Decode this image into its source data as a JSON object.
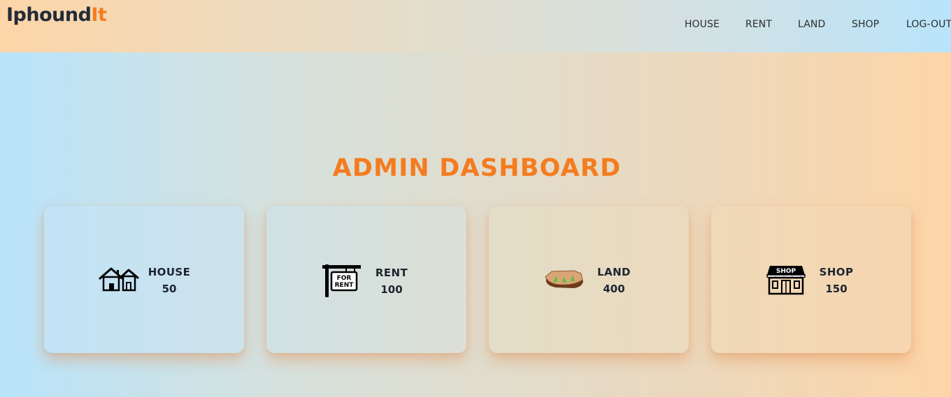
{
  "brand": {
    "name_main": "Iphound",
    "name_accent": "It"
  },
  "nav": {
    "items": [
      {
        "label": "HOUSE"
      },
      {
        "label": "RENT"
      },
      {
        "label": "LAND"
      },
      {
        "label": "SHOP"
      },
      {
        "label": "LOG-OUT"
      }
    ]
  },
  "page": {
    "title": "ADMIN DASHBOARD"
  },
  "cards": [
    {
      "label": "HOUSE",
      "count": "50",
      "icon": "houses-icon"
    },
    {
      "label": "RENT",
      "count": "100",
      "icon": "for-rent-sign-icon",
      "icon_text": "FOR RENT"
    },
    {
      "label": "LAND",
      "count": "400",
      "icon": "land-plot-icon"
    },
    {
      "label": "SHOP",
      "count": "150",
      "icon": "shop-storefront-icon",
      "icon_text": "SHOP"
    }
  ],
  "colors": {
    "accent": "#f47c20",
    "text_dark": "#222b38",
    "gradient_blue": "#b9e4fb",
    "gradient_peach": "#fdd5a8"
  }
}
